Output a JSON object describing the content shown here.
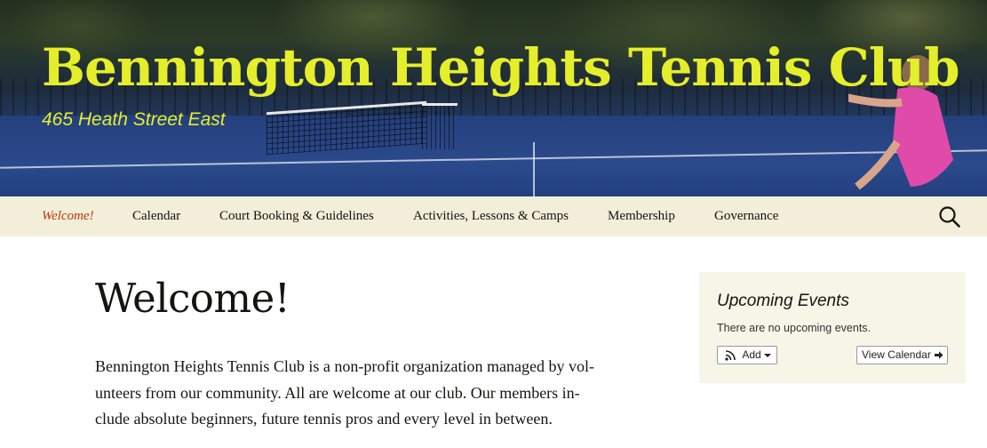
{
  "header": {
    "site_title": "Bennington Heights Tennis Club",
    "tagline": "465 Heath Street East",
    "title_color": "#e5ee2a"
  },
  "nav": {
    "items": [
      {
        "label": "Welcome!",
        "active": true
      },
      {
        "label": "Calendar",
        "active": false
      },
      {
        "label": "Court Booking & Guidelines",
        "active": false
      },
      {
        "label": "Activities, Lessons & Camps",
        "active": false
      },
      {
        "label": "Membership",
        "active": false
      },
      {
        "label": "Governance",
        "active": false
      }
    ],
    "search_icon": "search-icon",
    "active_color": "#bc360a",
    "background": "#f2eed9"
  },
  "main": {
    "title": "Welcome!",
    "paragraph_lines": [
      "Bennington Heights Tennis Club is a non-profit organization managed by vol-",
      "unteers from our community. All are welcome at our club. Our members in-",
      "clude absolute beginners, future tennis pros and every level in between."
    ]
  },
  "sidebar": {
    "widget_title": "Upcoming Events",
    "message": "There are no upcoming events.",
    "add_button": {
      "label": "Add",
      "icon": "rss-icon",
      "caret": "caret-down-icon"
    },
    "view_calendar_button": {
      "label": "View Calendar",
      "icon": "arrow-right-icon"
    },
    "background": "#f7f5e7"
  }
}
